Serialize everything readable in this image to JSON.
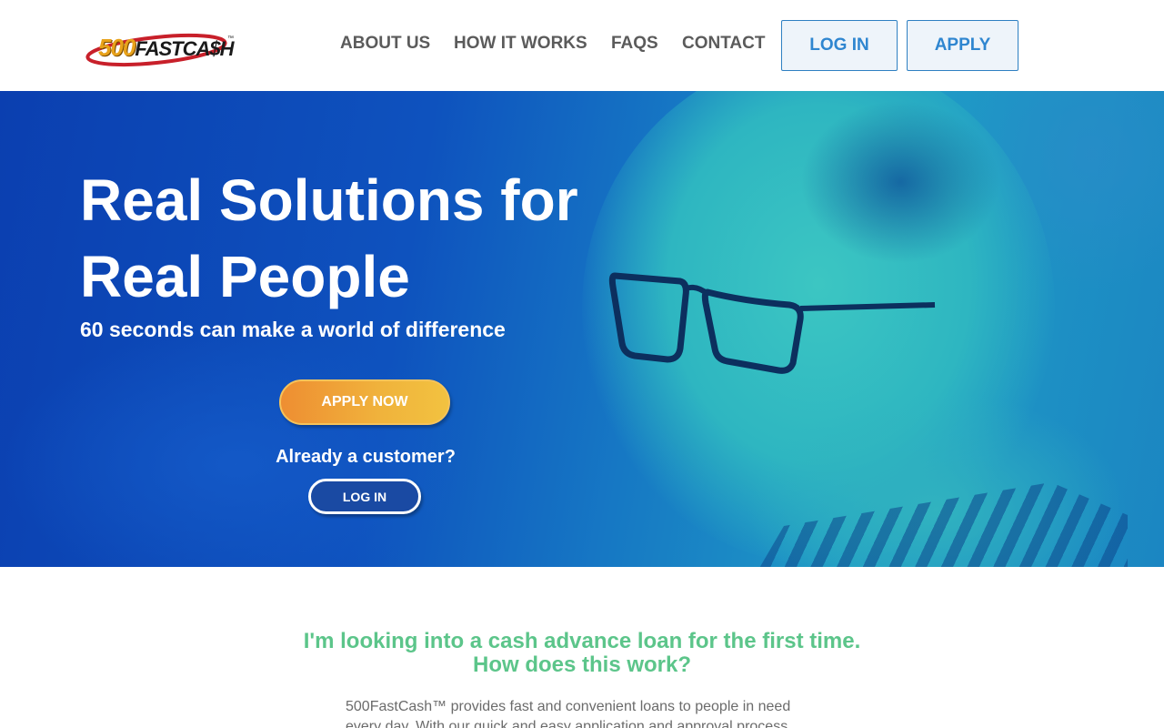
{
  "header": {
    "logo": {
      "number": "500",
      "text": "FASTCA$H",
      "tm": "™"
    },
    "nav": {
      "about": "ABOUT US",
      "how_it_works": "HOW IT WORKS",
      "faqs": "FAQS",
      "contact": "CONTACT"
    },
    "login_label": "LOG IN",
    "apply_label": "APPLY"
  },
  "hero": {
    "title_line1": "Real Solutions for",
    "title_line2": "Real People",
    "subtitle": "60 seconds can make a world of difference",
    "apply_now_label": "APPLY NOW",
    "already_customer": "Already a customer?",
    "login_label": "LOG IN"
  },
  "content": {
    "question_line1": "I'm looking into a cash advance loan for the first time.",
    "question_line2": "How does this work?",
    "answer": "500FastCash™ provides fast and convenient loans to people in need every day. With our quick and easy application and approval process,"
  },
  "colors": {
    "nav_text": "#5b5b5b",
    "button_blue": "#2f86d0",
    "hero_blue": "#0e52be",
    "hero_teal": "#3cc6c2",
    "apply_orange": "#ee8e32",
    "question_green": "#5cc58a"
  }
}
